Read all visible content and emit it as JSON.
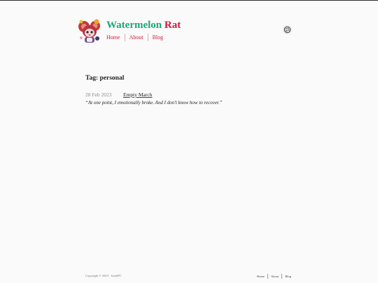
{
  "site": {
    "title_part1": "Watermelon",
    "title_part2": "Rat",
    "brand_green": "#1aa87a",
    "brand_red": "#d0183c"
  },
  "nav": {
    "items": [
      {
        "label": "Home"
      },
      {
        "label": "About"
      },
      {
        "label": "Blog"
      }
    ]
  },
  "theme_toggle": {
    "icon": "palette-icon"
  },
  "page": {
    "heading": "Tag: personal"
  },
  "posts": [
    {
      "date": "28 Feb 2023",
      "title": "Empty March",
      "excerpt": "“At one point, I emotionally broke. And I don’t know how to recover.”"
    }
  ],
  "footer": {
    "copyright": "Copyright © 2023 · JaykiPC",
    "nav": [
      {
        "label": "Home"
      },
      {
        "label": "About"
      },
      {
        "label": "Blog"
      }
    ]
  }
}
